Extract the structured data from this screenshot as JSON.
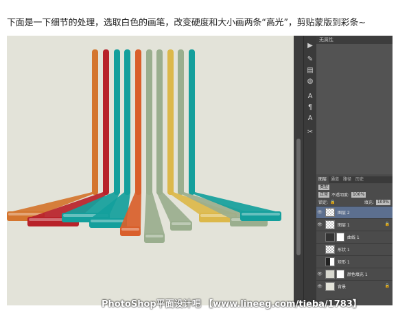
{
  "caption": "下面是一下细节的处理，选取白色的画笔，改变硬度和大小画两条“高光”，剪贴蒙版到彩条~",
  "canvas": {
    "background": "#e3e3d9",
    "stripe_colors": [
      "#d4752e",
      "#b8222a",
      "#149f9c",
      "#149f9c",
      "#d95f2b",
      "#9aae8e",
      "#9aae8e",
      "#dcb84a",
      "#9aae8e",
      "#149f9c"
    ]
  },
  "panel": {
    "properties_title": "无属性",
    "tabs": [
      "图层",
      "通道",
      "路径",
      "历史"
    ],
    "kind_label": "类型",
    "blend_mode": "正常",
    "opacity_label": "不透明度:",
    "opacity_value": "100%",
    "lock_label": "锁定:",
    "fill_label": "填充:",
    "fill_value": "100%",
    "layers": [
      {
        "name": "图层 2",
        "selected": true
      },
      {
        "name": "图层 1",
        "selected": false
      },
      {
        "name": "曲线 1",
        "selected": false
      },
      {
        "name": "形状 1",
        "selected": false
      },
      {
        "name": "矩形 1",
        "selected": false
      },
      {
        "name": "颜色填充 1",
        "selected": false
      },
      {
        "name": "背景",
        "selected": false
      }
    ]
  },
  "watermark": "PhotoShop平面设计吧 【www.lineeg.com/tieba/1783】"
}
